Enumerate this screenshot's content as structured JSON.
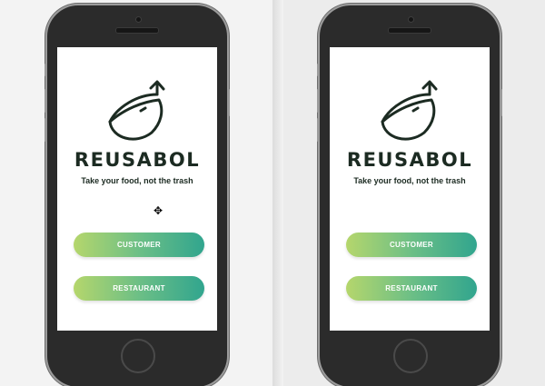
{
  "app": {
    "brand": "REUSABOL",
    "tagline": "Take your food, not the trash"
  },
  "buttons": {
    "customer": "CUSTOMER",
    "restaurant": "RESTAURANT"
  },
  "icons": {
    "logo": "bowl-with-arrow-icon",
    "cursor": "move-cursor-icon"
  },
  "colors": {
    "gradient_start": "#b5d66c",
    "gradient_end": "#31a58e",
    "text_dark": "#1c2b22"
  }
}
